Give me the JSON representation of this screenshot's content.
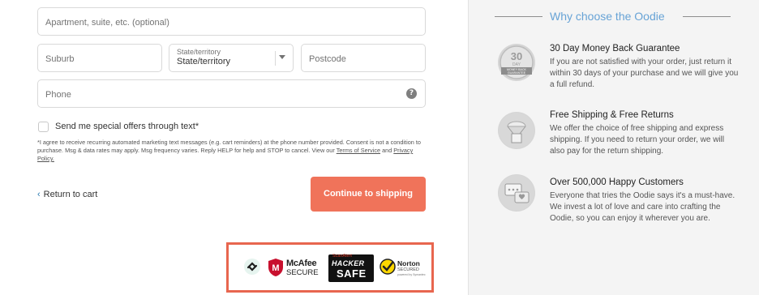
{
  "form": {
    "apartment_placeholder": "Apartment, suite, etc. (optional)",
    "suburb_placeholder": "Suburb",
    "state_label": "State/territory",
    "state_value": "State/territory",
    "postcode_placeholder": "Postcode",
    "phone_placeholder": "Phone",
    "help_glyph": "?",
    "offers_label": "Send me special offers through text*",
    "disclaimer_text": "*I agree to receive recurring automated marketing text messages (e.g. cart reminders) at the phone number provided. Consent is not a condition to purchase. Msg & data rates may apply. Msg frequency varies. Reply HELP for help and STOP to cancel. View our",
    "terms_link": "Terms of Service",
    "and_text": "and",
    "privacy_link": "Privacy Policy.",
    "return_label": "Return to cart",
    "return_arrow": "‹",
    "continue_label": "Continue to shipping"
  },
  "badges": {
    "mcafee_brand": "McAfee",
    "mcafee_secure": "SECURE",
    "mcafee_m": "M",
    "scanalert": "ScanAlert",
    "hacker": "HACKER",
    "safe": "SAFE",
    "norton": "Norton",
    "norton_secured": "SECURED",
    "powered_by": "powered by Symantec"
  },
  "sidebar": {
    "title": "Why choose the Oodie",
    "features": [
      {
        "title": "30 Day Money Back Guarantee",
        "desc": "If you are not satisfied with your order, just return it within 30 days of your purchase and we will give you a full refund.",
        "icon": "money-back-guarantee-icon",
        "icon_number": "30",
        "icon_day": "DAY",
        "icon_band1": "MONEY BACK",
        "icon_band2": "GUARANTEE"
      },
      {
        "title": "Free Shipping & Free Returns",
        "desc": "We offer the choice of free shipping and express shipping. If you need to return your order, we will also pay for the return shipping.",
        "icon": "parachute-box-icon"
      },
      {
        "title": "Over 500,000 Happy Customers",
        "desc": "Everyone that tries the Oodie says it's a must-have. We invest a lot of love and care into crafting the Oodie, so you can enjoy it wherever you are.",
        "icon": "chat-heart-icon"
      }
    ]
  },
  "colors": {
    "accent_button": "#f0735a",
    "link_blue": "#2a7ab0",
    "sidebar_title": "#67a3d6",
    "badge_highlight": "#e8664f"
  }
}
